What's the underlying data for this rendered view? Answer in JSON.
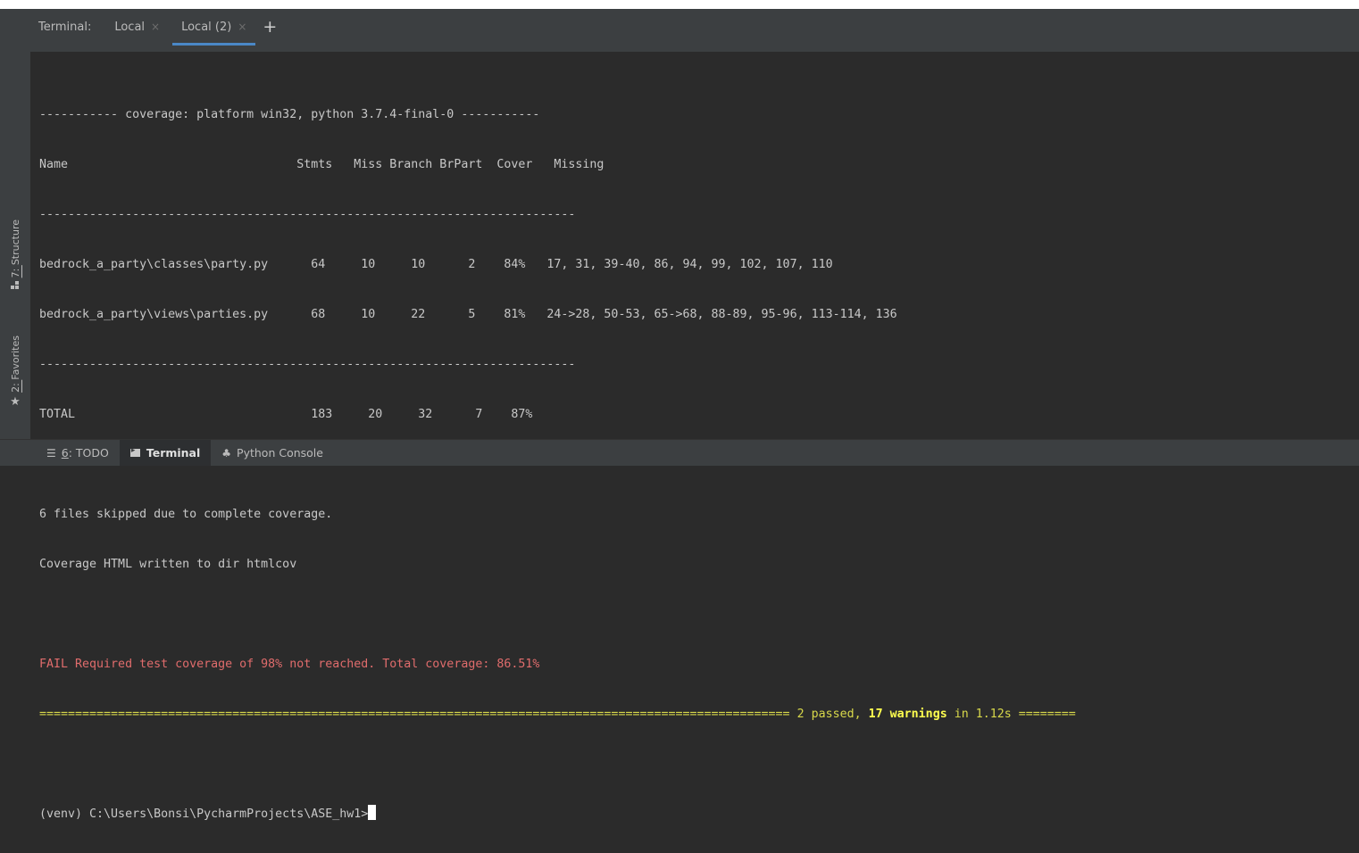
{
  "header": {
    "title": "Terminal:",
    "tabs": [
      {
        "label": "Local",
        "close": "×"
      },
      {
        "label": "Local (2)",
        "close": "×"
      }
    ],
    "add": "+"
  },
  "sidebar": {
    "structure": {
      "prefix": "7: ",
      "label": "Structure",
      "icon": "structure-icon"
    },
    "favorites": {
      "prefix": "2: ",
      "label": "Favorites",
      "icon": "star-icon"
    }
  },
  "terminal": {
    "lines": [
      "----------- coverage: platform win32, python 3.7.4-final-0 -----------",
      "Name                                Stmts   Miss Branch BrPart  Cover   Missing",
      "---------------------------------------------------------------------------",
      "bedrock_a_party\\classes\\party.py      64     10     10      2    84%   17, 31, 39-40, 86, 94, 99, 102, 107, 110",
      "bedrock_a_party\\views\\parties.py      68     10     22      5    81%   24->28, 50-53, 65->68, 88-89, 95-96, 113-114, 136",
      "---------------------------------------------------------------------------",
      "TOTAL                                 183     20     32      7    87%",
      "",
      "6 files skipped due to complete coverage.",
      "Coverage HTML written to dir htmlcov",
      "",
      "FAIL Required test coverage of 98% not reached. Total coverage: 86.51%"
    ],
    "summary": {
      "rule_left": "=========================================================================================================",
      "passed": " 2 passed, ",
      "warnings": "17 warnings",
      "time": " in 1.12s ",
      "rule_right": "========"
    },
    "prompt": "(venv) C:\\Users\\Bonsi\\PycharmProjects\\ASE_hw1>"
  },
  "bottom_tabs": [
    {
      "prefix": "6",
      "label": ": TODO",
      "icon": "todo-icon",
      "glyph": "☰"
    },
    {
      "label": "Terminal",
      "icon": "terminal-icon",
      "selected": true
    },
    {
      "label": "Python Console",
      "icon": "python-console-icon",
      "glyph": "♣"
    }
  ],
  "colors": {
    "background": "#2b2b2b",
    "panel": "#3c3f41",
    "fail": "#e06c6c",
    "separator": "#d8d84a",
    "tab_underline": "#4a88c7"
  }
}
